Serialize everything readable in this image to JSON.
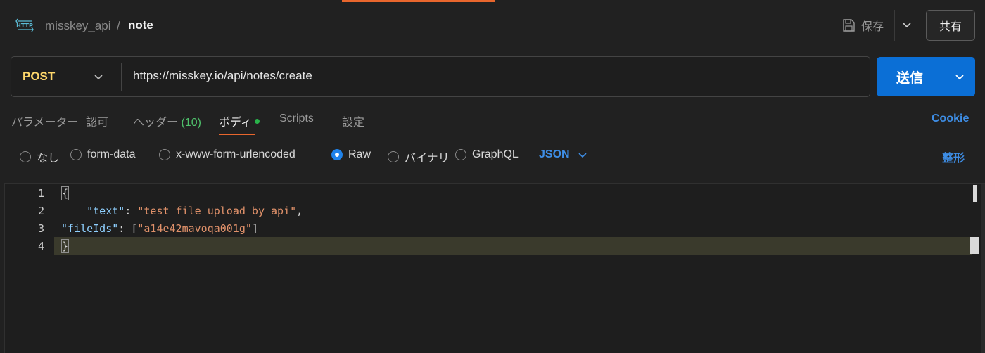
{
  "header": {
    "breadcrumb_parent": "misskey_api",
    "breadcrumb_separator": "/",
    "breadcrumb_current": "note",
    "save_label": "保存",
    "share_label": "共有",
    "icon": "http-icon"
  },
  "request": {
    "method": "POST",
    "url": "https://misskey.io/api/notes/create",
    "send_label": "送信"
  },
  "tabs": [
    {
      "label": "パラメーター"
    },
    {
      "label": "認可"
    },
    {
      "label": "ヘッダー",
      "count": "(10)"
    },
    {
      "label": "ボディ",
      "active": true
    },
    {
      "label": "Scripts"
    },
    {
      "label": "設定"
    }
  ],
  "cookie_label": "Cookie",
  "body_types": [
    {
      "label": "なし",
      "selected": false
    },
    {
      "label": "form-data",
      "selected": false
    },
    {
      "label": "x-www-form-urlencoded",
      "selected": false
    },
    {
      "label": "Raw",
      "selected": true
    },
    {
      "label": "バイナリ",
      "selected": false
    },
    {
      "label": "GraphQL",
      "selected": false
    }
  ],
  "raw_format": "JSON",
  "beautify_label": "整形",
  "editor": {
    "line_numbers": [
      "1",
      "2",
      "3",
      "4"
    ],
    "lines": [
      {
        "open_brace": "{"
      },
      {
        "indent": "    ",
        "key": "\"text\"",
        "colon": ": ",
        "value": "\"test file upload by api\"",
        "trail": ","
      },
      {
        "key": "\"fileIds\"",
        "colon": ": ",
        "bracket_open": "[",
        "value": "\"a14e42mavoqa001g\"",
        "bracket_close": "]"
      },
      {
        "close_brace": "}"
      }
    ]
  },
  "colors": {
    "accent_orange": "#e8662d",
    "method_yellow": "#ffd86b",
    "primary_blue": "#0b6fd6",
    "link_blue": "#3e8ee6",
    "status_green": "#29b34a"
  }
}
